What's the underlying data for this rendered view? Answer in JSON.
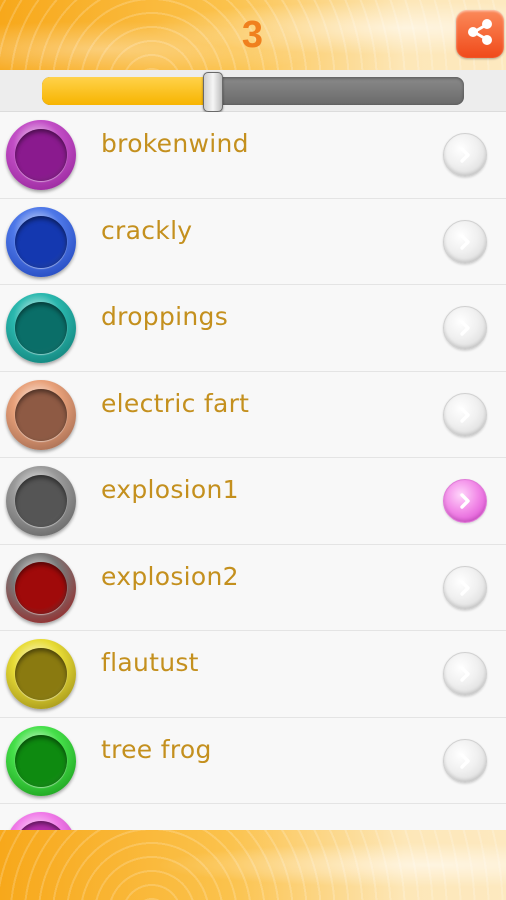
{
  "header": {
    "counter": "3",
    "share_icon": "share-icon",
    "accent_color": "#f0801e"
  },
  "volume_slider": {
    "value_fraction": 0.405,
    "fill_color": "#f7b400"
  },
  "sounds": [
    {
      "label": "brokenwind",
      "color": "#8a1a8e",
      "ring": "#c24ec6",
      "arrow_active": false
    },
    {
      "label": "crackly",
      "color": "#1438b0",
      "ring": "#4e78e8",
      "arrow_active": false
    },
    {
      "label": "droppings",
      "color": "#0a6e68",
      "ring": "#2ab8ae",
      "arrow_active": false
    },
    {
      "label": "electric fart",
      "color": "#8e5a44",
      "ring": "#e8a17a",
      "arrow_active": false
    },
    {
      "label": "explosion1",
      "color": "#555555",
      "ring": "#9a9a9a",
      "arrow_active": true
    },
    {
      "label": "explosion2",
      "color": "#a00a0a",
      "ring": "#7a7a7a",
      "arrow_active": false
    },
    {
      "label": "flautust",
      "color": "#8a7a10",
      "ring": "#e8dc36",
      "arrow_active": false
    },
    {
      "label": "tree frog",
      "color": "#0e8a10",
      "ring": "#46e04a",
      "arrow_active": false
    },
    {
      "label": "",
      "color": "#b02aa8",
      "ring": "#f07ae8",
      "arrow_active": false
    }
  ]
}
